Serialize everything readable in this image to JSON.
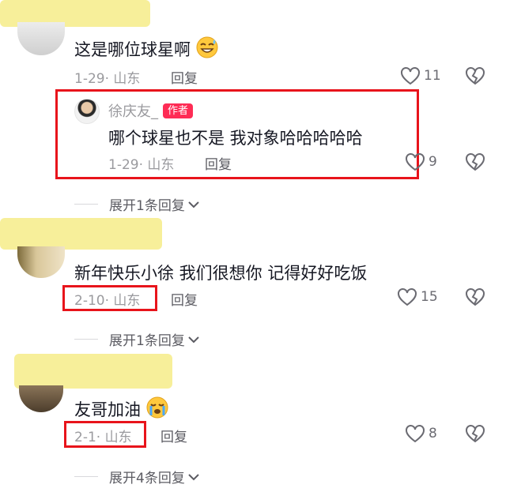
{
  "comments": [
    {
      "text": "这是哪位球星啊",
      "emoji_icon": "sweat-smile-emoji-icon",
      "meta": "1-29· 山东",
      "reply_label": "回复",
      "likes": "11",
      "reply": {
        "author": "徐庆友_",
        "author_badge": "作者",
        "text": "哪个球星也不是 我对象哈哈哈哈哈",
        "meta": "1-29· 山东",
        "reply_label": "回复",
        "likes": "9"
      },
      "expand_label": "展开1条回复"
    },
    {
      "text": "新年快乐小徐 我们很想你 记得好好吃饭",
      "meta": "2-10· 山东",
      "reply_label": "回复",
      "likes": "15",
      "expand_label": "展开1条回复"
    },
    {
      "text": "友哥加油",
      "emoji_icon": "crying-emoji-icon",
      "meta": "2-1· 山东",
      "reply_label": "回复",
      "likes": "8",
      "expand_label": "展开4条回复"
    }
  ],
  "colors": {
    "highlight_box": "#e8141b",
    "author_badge": "#fe2c55",
    "redaction_yellow": "#f7ef9a"
  }
}
